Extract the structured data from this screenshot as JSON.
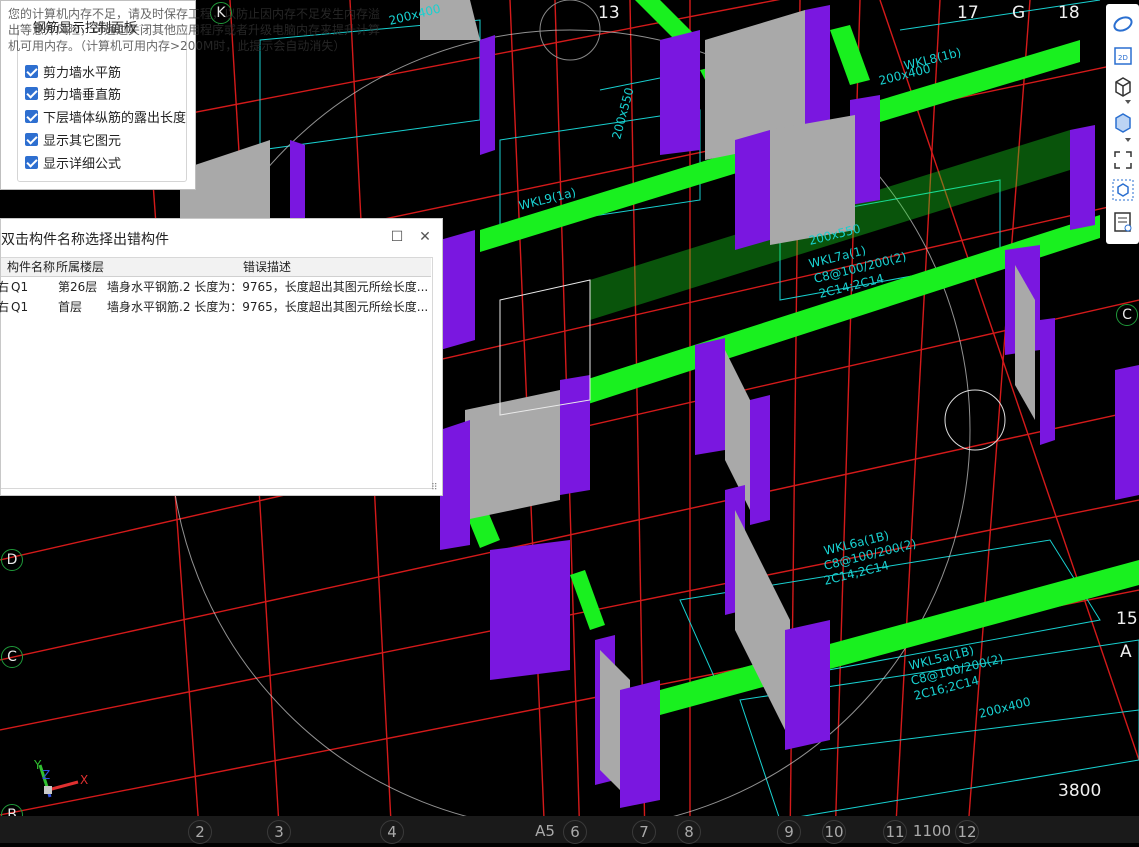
{
  "memory_warning": "您的计算机内存不足，请及时保存工程，以防止因内存不足发生内存溢出等意外风险，可通过关闭其他应用程序或者升级电脑内存来提升计算机可用内存。（计算机可用内存>200M时，此提示会自动消失）",
  "control_panel": {
    "title": "钢筋显示控制面板",
    "options": [
      {
        "label": "剪力墙水平筋",
        "checked": true
      },
      {
        "label": "剪力墙垂直筋",
        "checked": true
      },
      {
        "label": "下层墙体纵筋的露出长度",
        "checked": true
      },
      {
        "label": "显示其它图元",
        "checked": true
      },
      {
        "label": "显示详细公式",
        "checked": true
      }
    ]
  },
  "error_dialog": {
    "title": "双击构件名称选择出错构件",
    "columns": [
      "构件名称",
      "所属楼层",
      "错误描述"
    ],
    "rows": [
      {
        "type": "右",
        "name": "Q1",
        "floor": "第26层",
        "desc": "墙身水平钢筋.2 长度为：9765，长度超出其图元所绘长度..."
      },
      {
        "type": "右",
        "name": "Q1",
        "floor": "首层",
        "desc": "墙身水平钢筋.2 长度为：9765，长度超出其图元所绘长度..."
      }
    ]
  },
  "axis_labels_top": [
    "K",
    "13",
    "17",
    "G",
    "18"
  ],
  "axis_labels_left": [
    "D",
    "C",
    "B"
  ],
  "axis_labels_right": [
    "C",
    "15",
    "A"
  ],
  "axis_labels_bottom": [
    "2",
    "3",
    "4",
    "A5",
    "6",
    "7",
    "8",
    "9",
    "10",
    "11",
    "12"
  ],
  "dimension_labels": [
    "3800",
    "1100"
  ],
  "beam_annotations": [
    "200x400",
    "200x550",
    "WKL9(1a)",
    "200x400",
    "200x550",
    "WKL8(1b)",
    "WKL7a(1)",
    "C8@100/200(2)",
    "2C14;2C14",
    "WKL6a(1B)",
    "C8@100/200(2)",
    "2C14;2C14",
    "WKL5a(1B)",
    "C8@100/200(2)",
    "2C16;2C14",
    "200x400"
  ],
  "gizmo_axes": {
    "x": "X",
    "y": "Y",
    "z": "Z"
  },
  "colors": {
    "wall_purple": "#7a17e0",
    "beam_green": "#19f01f",
    "grid_red": "#d41a1a",
    "annotation_cyan": "#18d0d0",
    "wall_gray": "#a9a9a9"
  },
  "toolbar_icons": [
    "orbit-icon",
    "2d-view-icon",
    "3d-box-icon",
    "3d-solid-icon",
    "fullscreen-icon",
    "cube-view-icon",
    "properties-icon"
  ]
}
